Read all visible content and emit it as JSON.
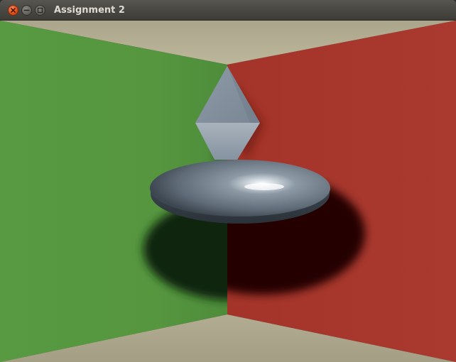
{
  "window": {
    "title": "Assignment 2"
  },
  "icons": {
    "close": "close-icon",
    "minimize": "minimize-icon",
    "maximize": "maximize-icon"
  },
  "colors": {
    "left_wall": "#55963f",
    "right_wall": "#a8372e",
    "floor_ceiling": "#aaa48a",
    "object_metal": "#7a8794",
    "close_button": "#df4a16",
    "titlebar": "#3d3c37",
    "title_text": "#dfdbd2"
  }
}
